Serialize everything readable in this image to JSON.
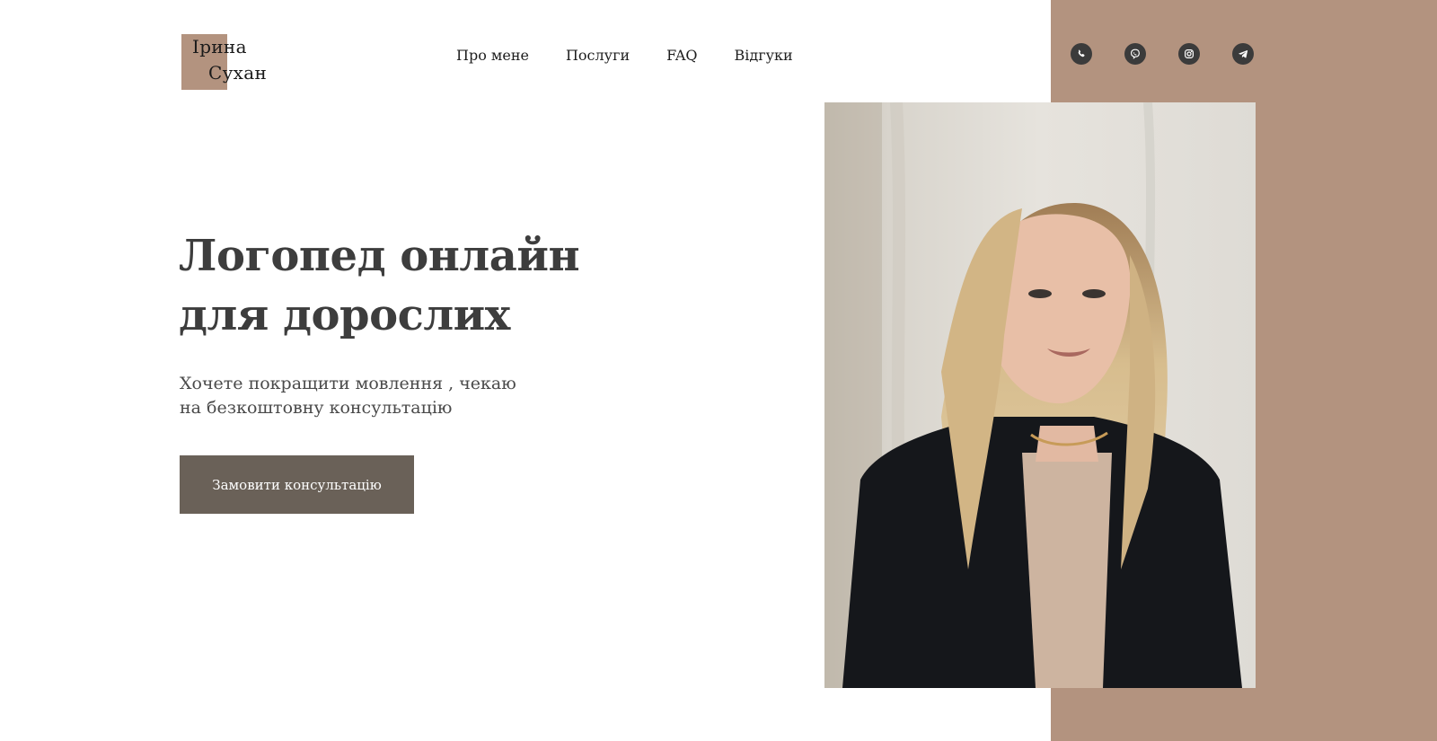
{
  "logo": {
    "line1": "Ірина",
    "line2": "Сухан"
  },
  "nav": {
    "items": [
      {
        "label": "Про мене"
      },
      {
        "label": "Послуги"
      },
      {
        "label": "FAQ"
      },
      {
        "label": "Відгуки"
      }
    ]
  },
  "socials": [
    {
      "name": "whatsapp-icon"
    },
    {
      "name": "viber-icon"
    },
    {
      "name": "instagram-icon"
    },
    {
      "name": "telegram-icon"
    }
  ],
  "hero": {
    "title": "Логопед онлайн для дорослих",
    "subtitle": "Хочете покращити мовлення , чекаю на безкоштовну консультацію",
    "cta_label": "Замовити консультацію"
  },
  "colors": {
    "accent": "#b3937f",
    "button": "#6a6158",
    "text": "#3d3d3d"
  }
}
